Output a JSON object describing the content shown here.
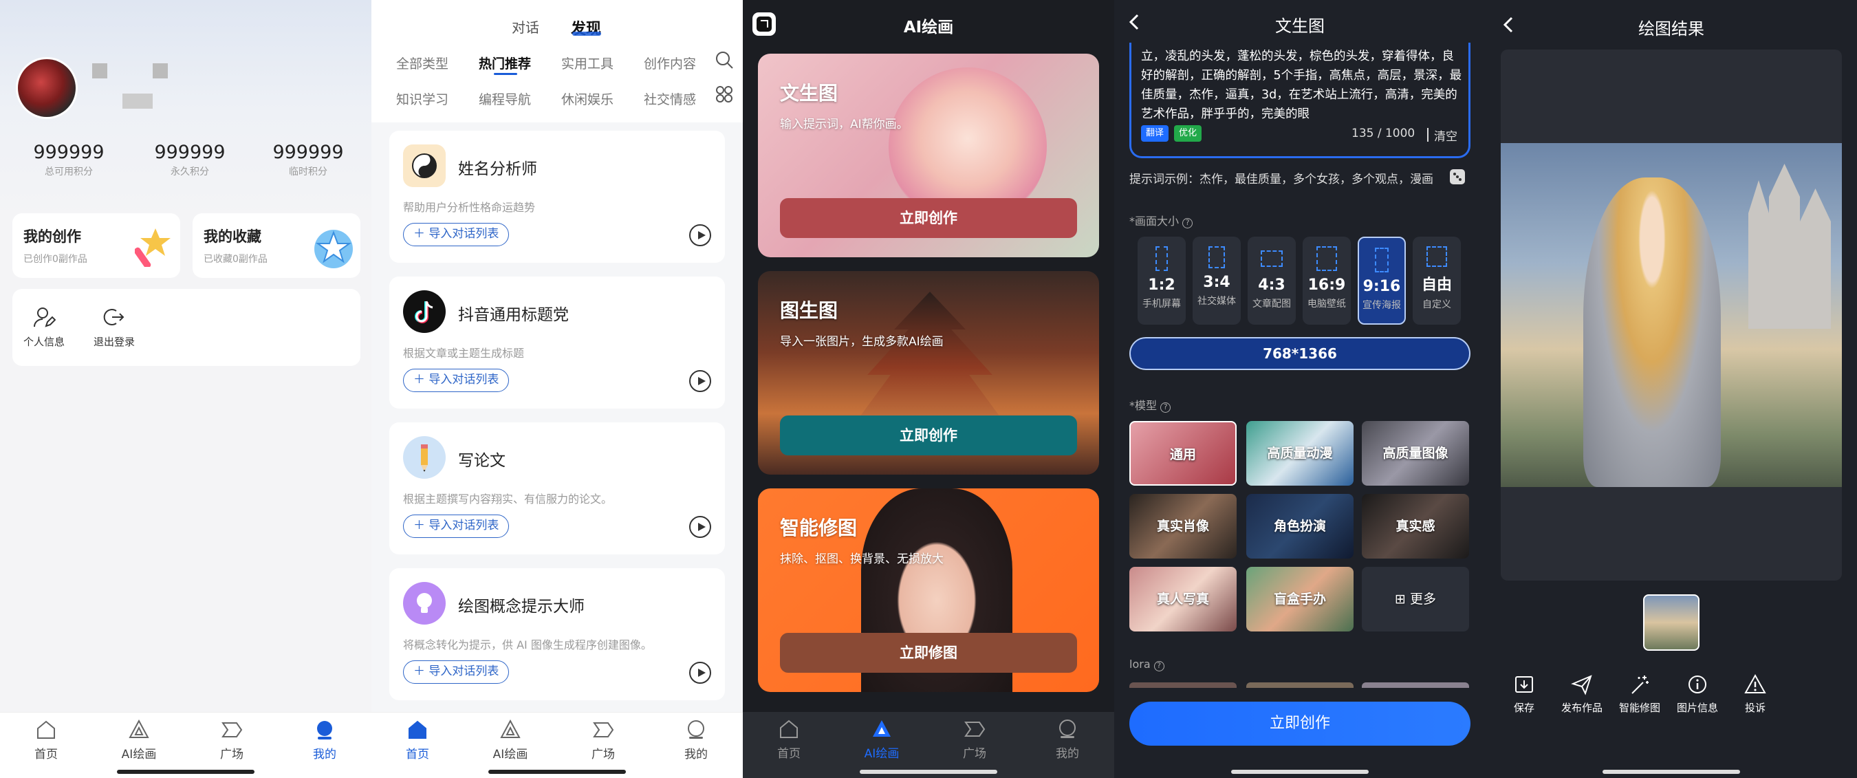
{
  "tabs": {
    "home": "首页",
    "ai_draw": "AI绘画",
    "square": "广场",
    "mine": "我的"
  },
  "profile": {
    "points": [
      {
        "value": "999999",
        "label": "总可用积分"
      },
      {
        "value": "999999",
        "label": "永久积分"
      },
      {
        "value": "999999",
        "label": "临时积分"
      }
    ],
    "my_creation": {
      "title": "我的创作",
      "sub": "已创作0副作品"
    },
    "my_collection": {
      "title": "我的收藏",
      "sub": "已收藏0副作品"
    },
    "personal_info": "个人信息",
    "logout": "退出登录"
  },
  "discover": {
    "top_tabs": [
      "对话",
      "发现"
    ],
    "categories_row1": [
      "全部类型",
      "热门推荐",
      "实用工具",
      "创作内容"
    ],
    "categories_row2": [
      "知识学习",
      "编程导航",
      "休闲娱乐",
      "社交情感"
    ],
    "import_label": "导入对话列表",
    "cards": [
      {
        "title": "姓名分析师",
        "desc": "帮助用户分析性格命运趋势"
      },
      {
        "title": "抖音通用标题党",
        "desc": "根据文章或主题生成标题"
      },
      {
        "title": "写论文",
        "desc": "根据主题撰写内容翔实、有信服力的论文。"
      },
      {
        "title": "绘图概念提示大师",
        "desc": "将概念转化为提示，供 AI 图像生成程序创建图像。"
      }
    ]
  },
  "ai_draw": {
    "title": "AI绘画",
    "cards": [
      {
        "title": "文生图",
        "sub": "输入提示词，AI帮你画。",
        "button": "立即创作",
        "btn_color": "#b2494d"
      },
      {
        "title": "图生图",
        "sub": "导入一张图片，生成多款AI绘画",
        "button": "立即创作",
        "btn_color": "#0f6f77"
      },
      {
        "title": "智能修图",
        "sub": "抹除、抠图、换背景、无损放大",
        "button": "立即修图",
        "btn_color": "#8a4a35"
      }
    ]
  },
  "txt2img": {
    "title": "文生图",
    "prompt_text": "立，凌乱的头发，蓬松的头发，棕色的头发，穿着得体，良好的解剖，正确的解剖，5个手指，高焦点，高层，景深，最佳质量，杰作，逼真，3d，在艺术站上流行，高清，完美的艺术作品，胖乎乎的，完美的眼",
    "translate": "翻译",
    "optimize": "优化",
    "counter": "135 / 1000",
    "clear": "清空",
    "example": "提示词示例：杰作，最佳质量，多个女孩，多个观点，漫画",
    "size_label": "*画面大小",
    "ratios": [
      {
        "r": "1:2",
        "s": "手机屏幕"
      },
      {
        "r": "3:4",
        "s": "社交媒体"
      },
      {
        "r": "4:3",
        "s": "文章配图"
      },
      {
        "r": "16:9",
        "s": "电脑壁纸"
      },
      {
        "r": "9:16",
        "s": "宣传海报"
      },
      {
        "r": "自由",
        "s": "自定义"
      }
    ],
    "resolution": "768*1366",
    "model_label": "*模型",
    "models": [
      "通用",
      "高质量动漫",
      "高质量图像",
      "真实肖像",
      "角色扮演",
      "真实感",
      "真人写真",
      "盲盒手办",
      "更多"
    ],
    "lora_label": "lora",
    "create_button": "立即创作"
  },
  "result": {
    "title": "绘图结果",
    "actions": [
      "保存",
      "发布作品",
      "智能修图",
      "图片信息",
      "投诉"
    ]
  },
  "colors": {
    "primary_blue": "#1e6cff",
    "active_tab": "#1a5cd8",
    "panel_dark": "#1e2128"
  }
}
